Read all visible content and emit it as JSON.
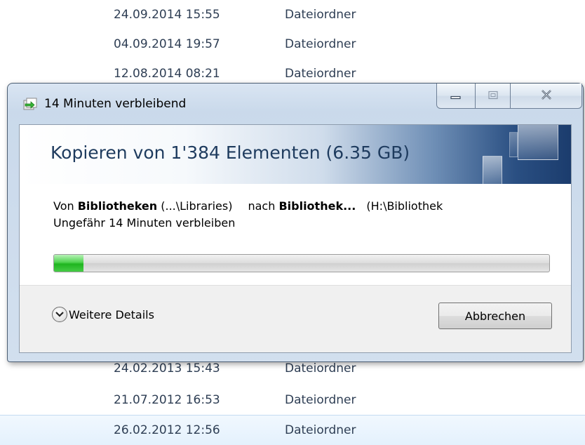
{
  "background_rows": [
    {
      "date": "24.09.2014 15:55",
      "type": "Dateiordner"
    },
    {
      "date": "04.09.2014 19:57",
      "type": "Dateiordner"
    },
    {
      "date": "12.08.2014 08:21",
      "type": "Dateiordner"
    },
    {
      "date": "24.02.2013 15:43",
      "type": "Dateiordner"
    },
    {
      "date": "21.07.2012 16:53",
      "type": "Dateiordner"
    },
    {
      "date": "26.02.2012 12:56",
      "type": "Dateiordner"
    }
  ],
  "window": {
    "title": "14 Minuten verbleibend",
    "icon": "copy-arrow-icon"
  },
  "dialog": {
    "header": "Kopieren von 1'384 Elementen (6.35 GB)",
    "from_prefix": "Von ",
    "from_name": "Bibliotheken",
    "from_path": " (...\\Libraries)",
    "to_prefix": "nach ",
    "to_name": "Bibliothek...",
    "to_path": " (H:\\Bibliothek",
    "time_remaining": "Ungefähr 14 Minuten verbleiben",
    "progress_percent": 6,
    "progress_color": "#1fb51f"
  },
  "footer": {
    "details_label": "Weitere Details",
    "cancel_label": "Abbrechen"
  }
}
